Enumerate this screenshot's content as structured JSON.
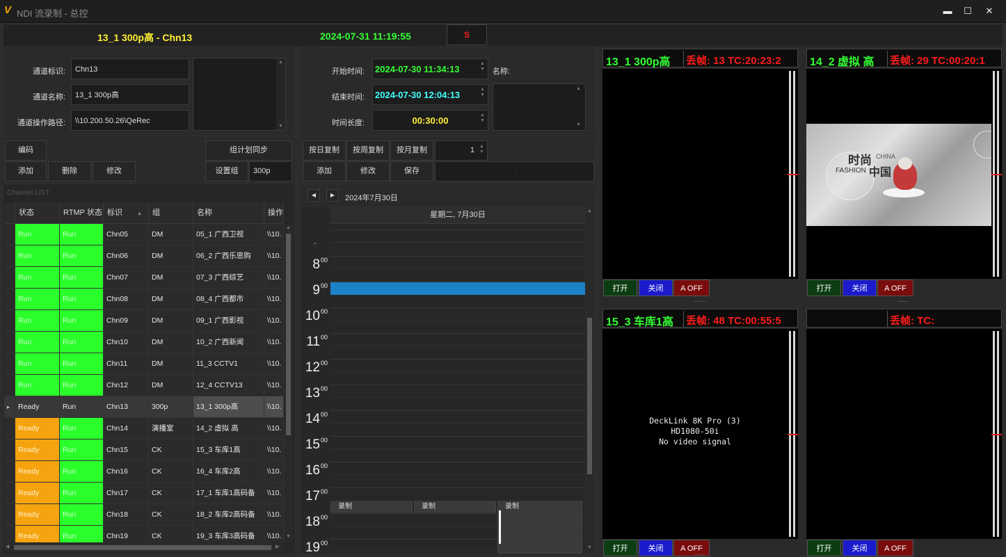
{
  "window": {
    "logo": "V",
    "title": "NDI 流录制 - 总控",
    "min": "▬",
    "max": "☐",
    "close": "✕"
  },
  "header": {
    "channel": "13_1 300p高 - Chn13",
    "datetime": "2024-07-31 11:19:55",
    "status_letter": "S"
  },
  "channel_form": {
    "id_label": "通道标识:",
    "id_value": "Chn13",
    "name_label": "通道名称:",
    "name_value": "13_1 300p高",
    "path_label": "通道操作路径:",
    "path_value": "\\\\10.200.50.26\\QeRec"
  },
  "left_buttons": {
    "encode": "编码",
    "sync": "组计划同步",
    "add": "添加",
    "delete": "删除",
    "modify": "修改",
    "set_group": "设置组",
    "group_value": "300p"
  },
  "schedule_form": {
    "start_label": "开始时间:",
    "start_value": "2024-07-30 11:34:13",
    "end_label": "结束时间:",
    "end_value": "2024-07-30 12:04:13",
    "duration_label": "时间长度:",
    "duration_value": "00:30:00",
    "name_label": "名称:"
  },
  "schedule_buttons": {
    "copy_day": "按日复制",
    "copy_week": "按周复制",
    "copy_month": "按月复制",
    "count": "1",
    "add": "添加",
    "modify": "修改",
    "save": "保存",
    "dot": "·"
  },
  "channel_list": {
    "title": "Channel LIST",
    "columns": [
      "状态",
      "RTMP 状态",
      "标识",
      "组",
      "名称",
      "操作路径"
    ],
    "sort_arrow": "▲",
    "rows": [
      {
        "status": "Run",
        "rtmp": "Run",
        "id": "Chn05",
        "group": "DM",
        "name": "05_1 广西卫视",
        "path": "\\\\10."
      },
      {
        "status": "Run",
        "rtmp": "Run",
        "id": "Chn06",
        "group": "DM",
        "name": "06_2 广西乐思购",
        "path": "\\\\10."
      },
      {
        "status": "Run",
        "rtmp": "Run",
        "id": "Chn07",
        "group": "DM",
        "name": "07_3 广西综艺",
        "path": "\\\\10."
      },
      {
        "status": "Run",
        "rtmp": "Run",
        "id": "Chn08",
        "group": "DM",
        "name": "08_4 广西都市",
        "path": "\\\\10."
      },
      {
        "status": "Run",
        "rtmp": "Run",
        "id": "Chn09",
        "group": "DM",
        "name": "09_1 广西影视",
        "path": "\\\\10."
      },
      {
        "status": "Run",
        "rtmp": "Run",
        "id": "Chn10",
        "group": "DM",
        "name": "10_2 广西新闻",
        "path": "\\\\10."
      },
      {
        "status": "Run",
        "rtmp": "Run",
        "id": "Chn11",
        "group": "DM",
        "name": "11_3 CCTV1",
        "path": "\\\\10."
      },
      {
        "status": "Run",
        "rtmp": "Run",
        "id": "Chn12",
        "group": "DM",
        "name": "12_4 CCTV13",
        "path": "\\\\10."
      },
      {
        "status": "Ready",
        "rtmp": "Run",
        "id": "Chn13",
        "group": "300p",
        "name": "13_1 300p高",
        "path": "\\\\10.",
        "selected": true
      },
      {
        "status": "Ready",
        "rtmp": "Run",
        "id": "Chn14",
        "group": "演播室",
        "name": "14_2 虚拟 高",
        "path": "\\\\10."
      },
      {
        "status": "Ready",
        "rtmp": "Run",
        "id": "Chn15",
        "group": "CK",
        "name": "15_3 车库1高",
        "path": "\\\\10."
      },
      {
        "status": "Ready",
        "rtmp": "Run",
        "id": "Chn16",
        "group": "CK",
        "name": "16_4 车库2高",
        "path": "\\\\10."
      },
      {
        "status": "Ready",
        "rtmp": "Run",
        "id": "Chn17",
        "group": "CK",
        "name": "17_1 车库1高码备",
        "path": "\\\\10."
      },
      {
        "status": "Ready",
        "rtmp": "Run",
        "id": "Chn18",
        "group": "CK",
        "name": "18_2 车库2高码备",
        "path": "\\\\10."
      },
      {
        "status": "Ready",
        "rtmp": "Run",
        "id": "Chn19",
        "group": "CK",
        "name": "19_3 车库3高码备",
        "path": "\\\\10."
      }
    ]
  },
  "calendar": {
    "date_label": "2024年7月30日",
    "prev": "◀",
    "next": "▶",
    "day_header": "星期二, 7月30日",
    "dash": "-",
    "hours": [
      "8",
      "9",
      "10",
      "11",
      "12",
      "13",
      "14",
      "15",
      "16",
      "17",
      "18",
      "19"
    ],
    "minutes_sup": "00",
    "events": [
      "录制",
      "录制",
      "录制"
    ]
  },
  "monitors": [
    {
      "name": "13_1 300p高",
      "stat": "丢帧: 13 TC:20:23:2",
      "open": "打开",
      "close": "关闭",
      "off": "A OFF"
    },
    {
      "name": "14_2 虚拟 高",
      "stat": "丢帧: 29 TC:00:20:1",
      "open": "打开",
      "close": "关闭",
      "off": "A OFF",
      "thumb_text_top": "时尚",
      "thumb_text_a": "CHINA",
      "thumb_text_b": "FASHION",
      "thumb_text_c": "中国"
    },
    {
      "name": "15_3 车库1高",
      "stat": "丢帧: 48 TC:00:55:5",
      "open": "打开",
      "close": "关闭",
      "off": "A OFF",
      "signal_line1": "DeckLink 8K Pro (3)",
      "signal_line2": "HD1080-50i",
      "signal_line3": "No video signal"
    },
    {
      "name": "",
      "stat": "丢帧:  TC:",
      "open": "打开",
      "close": "关闭",
      "off": "A OFF"
    }
  ],
  "colors": {
    "run": "#2bff2b",
    "ready": "#f5a30e",
    "selected_row": "#505050",
    "event": "#1b82c8",
    "name_green": "#33ff33",
    "stat_red": "#ff1c1c"
  }
}
